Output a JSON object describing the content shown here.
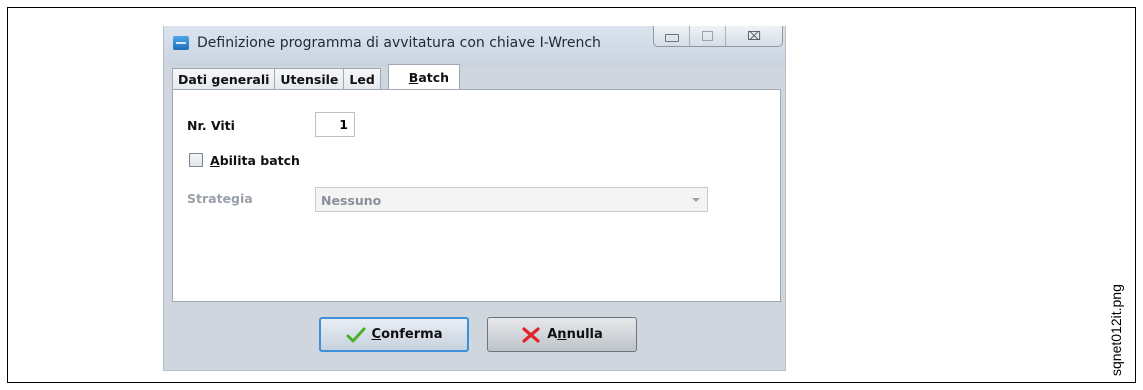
{
  "caption": "sqnet012it.png",
  "window": {
    "title": "Definizione programma di avvitatura con chiave I-Wrench",
    "controls": {
      "minimize": "minimize-icon",
      "maximize": "maximize-icon",
      "close_glyph": "⌧"
    }
  },
  "tabs": [
    {
      "label": "Dati generali"
    },
    {
      "label": "Utensile"
    },
    {
      "label": "Led"
    },
    {
      "label_underlined": "B",
      "label_rest": "atch",
      "active": true
    }
  ],
  "batch": {
    "nr_viti_label": "Nr. Viti",
    "nr_viti_value": "1",
    "abilita_label_underlined": "A",
    "abilita_label_rest": "bilita batch",
    "abilita_checked": false,
    "strategia_label": "Strategia",
    "strategia_value": "Nessuno"
  },
  "buttons": {
    "confirm_underlined": "C",
    "confirm_rest": "onferma",
    "cancel_first": "A",
    "cancel_underlined": "n",
    "cancel_rest": "nulla"
  }
}
